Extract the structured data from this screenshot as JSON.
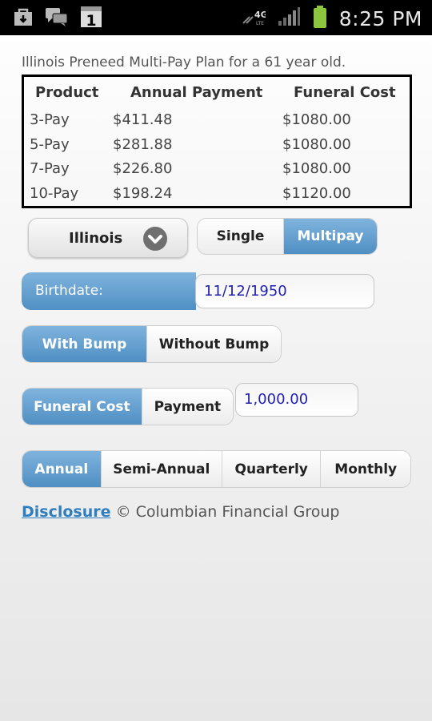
{
  "status_bar": {
    "time": "8:25 PM",
    "network": "4G"
  },
  "plan_title": "Illinois Preneed Multi-Pay Plan for a 61 year old.",
  "rates_table": {
    "headers": [
      "Product",
      "Annual Payment",
      "Funeral Cost"
    ],
    "rows": [
      [
        "3-Pay",
        "$411.48",
        "$1080.00"
      ],
      [
        "5-Pay",
        "$281.88",
        "$1080.00"
      ],
      [
        "7-Pay",
        "$226.80",
        "$1080.00"
      ],
      [
        "10-Pay",
        "$198.24",
        "$1120.00"
      ]
    ]
  },
  "state_select": {
    "value": "Illinois"
  },
  "plan_type": {
    "options": [
      "Single",
      "Multipay"
    ],
    "selected": "Multipay"
  },
  "birthdate": {
    "label": "Birthdate:",
    "value": "11/12/1950"
  },
  "bump": {
    "options": [
      "With Bump",
      "Without Bump"
    ],
    "selected": "With Bump"
  },
  "calc_mode": {
    "options": [
      "Funeral Cost",
      "Payment"
    ],
    "selected": "Funeral Cost"
  },
  "amount": {
    "value": "1,000.00"
  },
  "frequency": {
    "options": [
      "Annual",
      "Semi-Annual",
      "Quarterly",
      "Monthly"
    ],
    "selected": "Annual"
  },
  "footer": {
    "disclosure_link": "Disclosure",
    "copyright": "© Columbian Financial Group"
  },
  "colors": {
    "accent": "#5a98cb",
    "input_text": "#2121b0",
    "link": "#2f7fc0"
  }
}
